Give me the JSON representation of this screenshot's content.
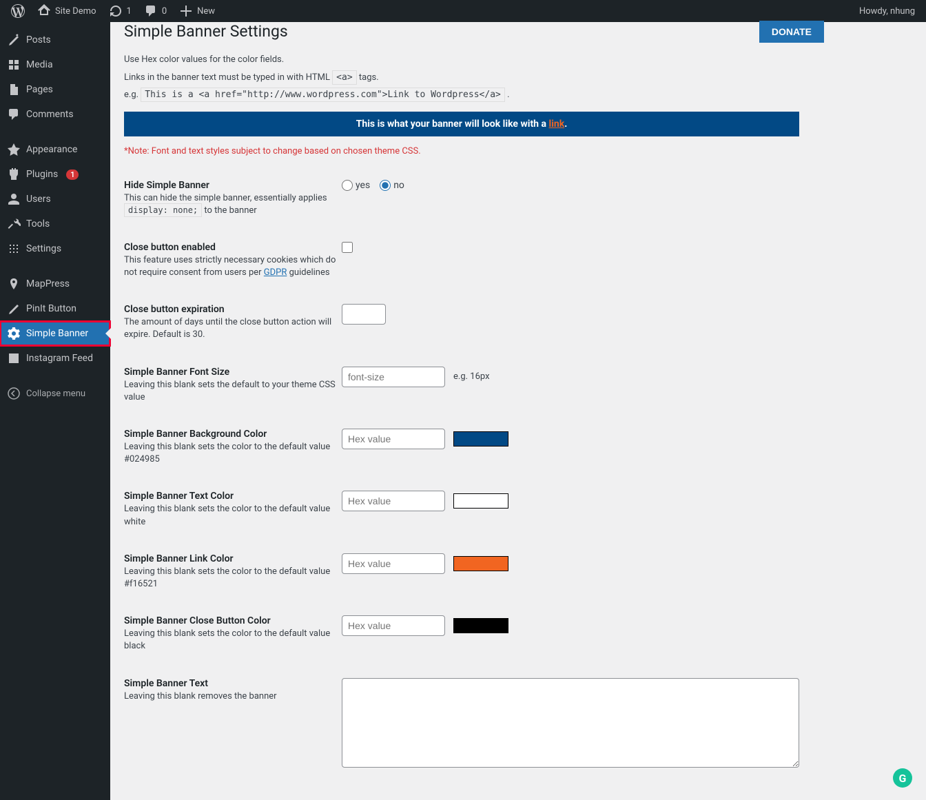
{
  "adminbar": {
    "site": "Site Demo",
    "updates": "1",
    "comments": "0",
    "new": "New",
    "howdy": "Howdy, nhung"
  },
  "sidebar": {
    "items": [
      {
        "label": "Posts"
      },
      {
        "label": "Media"
      },
      {
        "label": "Pages"
      },
      {
        "label": "Comments"
      },
      {
        "label": "Appearance"
      },
      {
        "label": "Plugins",
        "badge": "1"
      },
      {
        "label": "Users"
      },
      {
        "label": "Tools"
      },
      {
        "label": "Settings"
      },
      {
        "label": "MapPress"
      },
      {
        "label": "PinIt Button"
      },
      {
        "label": "Simple Banner"
      },
      {
        "label": "Instagram Feed"
      }
    ],
    "collapse": "Collapse menu"
  },
  "page": {
    "title": "Simple Banner Settings",
    "donate": "Donate",
    "intro1": "Use Hex color values for the color fields.",
    "intro2_a": "Links in the banner text must be typed in with HTML ",
    "intro2_code": "<a>",
    "intro2_b": " tags.",
    "intro3_a": "e.g. ",
    "intro3_code": "This is a <a href=\"http://www.wordpress.com\">Link to Wordpress</a>",
    "intro3_b": " .",
    "banner_preview_a": "This is what your banner will look like with a ",
    "banner_preview_link": "link",
    "banner_preview_b": ".",
    "note": "*Note: Font and text styles subject to change based on chosen theme CSS."
  },
  "fields": {
    "hide": {
      "label": "Hide Simple Banner",
      "desc_a": "This can hide the simple banner, essentially applies ",
      "desc_code": "display: none;",
      "desc_b": " to the banner",
      "yes": "yes",
      "no": "no"
    },
    "close_enabled": {
      "label": "Close button enabled",
      "desc_a": "This feature uses strictly necessary cookies which do not require consent from users per ",
      "desc_link": "GDPR",
      "desc_b": " guidelines"
    },
    "close_exp": {
      "label": "Close button expiration",
      "desc": "The amount of days until the close button action will expire. Default is 30."
    },
    "font_size": {
      "label": "Simple Banner Font Size",
      "desc": "Leaving this blank sets the default to your theme CSS value",
      "placeholder": "font-size",
      "hint": "e.g. 16px"
    },
    "bg_color": {
      "label": "Simple Banner Background Color",
      "desc": "Leaving this blank sets the color to the default value #024985",
      "placeholder": "Hex value",
      "swatch": "#024985"
    },
    "text_color": {
      "label": "Simple Banner Text Color",
      "desc": "Leaving this blank sets the color to the default value white",
      "placeholder": "Hex value",
      "swatch": "#ffffff"
    },
    "link_color": {
      "label": "Simple Banner Link Color",
      "desc": "Leaving this blank sets the color to the default value #f16521",
      "placeholder": "Hex value",
      "swatch": "#f16521"
    },
    "close_color": {
      "label": "Simple Banner Close Button Color",
      "desc": "Leaving this blank sets the color to the default value black",
      "placeholder": "Hex value",
      "swatch": "#000000"
    },
    "text": {
      "label": "Simple Banner Text",
      "desc": "Leaving this blank removes the banner"
    }
  }
}
